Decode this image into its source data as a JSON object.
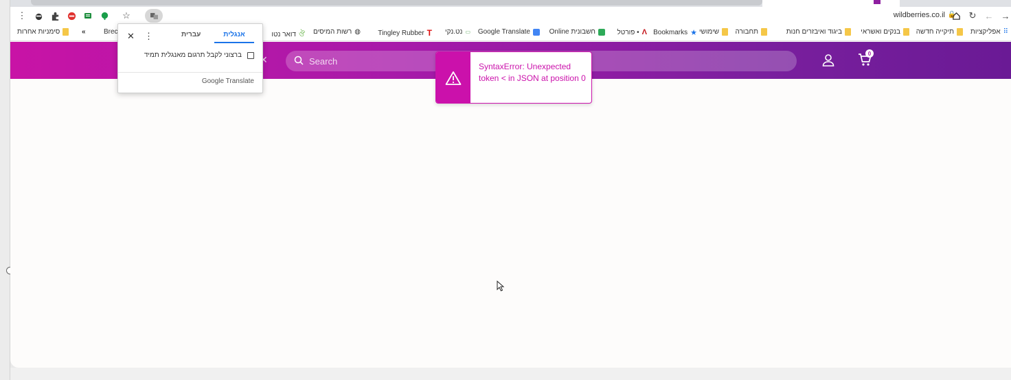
{
  "browser": {
    "url": "wildberries.co.il",
    "lock_glyph": "🔒"
  },
  "bookmarks": [
    {
      "label": "אפליקציות",
      "icon": "apps-grid-icon"
    },
    {
      "label": "תיקייה חדשה",
      "icon": "folder-icon"
    },
    {
      "label": "בנקים ואשראי",
      "icon": "folder-icon"
    },
    {
      "label": "ביגוד ואיבזרים חנות",
      "icon": "folder-icon"
    },
    {
      "label": "תחבורה",
      "icon": "folder-icon"
    },
    {
      "label": "שימושי",
      "icon": "folder-icon"
    },
    {
      "label": "Bookmarks",
      "icon": "star-icon"
    },
    {
      "label": "• פורטל",
      "icon": "red-logo-icon"
    },
    {
      "label": "חשבונית Online",
      "icon": "green-logo-icon"
    },
    {
      "label": "Google Translate",
      "icon": "translate-icon"
    },
    {
      "label": "נט.נקי",
      "icon": "flag-icon"
    },
    {
      "label": "Tingley Rubber",
      "icon": "t-logo-icon"
    },
    {
      "label": "רשות המיסים",
      "icon": "globe-icon"
    },
    {
      "label": "דואר נטו",
      "icon": "leaf-icon"
    },
    {
      "label": "Brecr",
      "icon": "none"
    },
    {
      "label": "»",
      "icon": "none"
    },
    {
      "label": "סימניות אחרות",
      "icon": "folder-icon"
    }
  ],
  "translate_popup": {
    "tab_active": "אנגלית",
    "tab_inactive": "עברית",
    "always_translate_label": "ברצוני לקבל תרגום מאנגלית תמיד",
    "brand": "Google Translate"
  },
  "header": {
    "search_placeholder": "Search",
    "cart_count": "0",
    "accent": "#cb11ab"
  },
  "toast": {
    "message": "SyntaxError: Unexpected token < in JSON at position 0",
    "icon": "warning-triangle-icon"
  }
}
